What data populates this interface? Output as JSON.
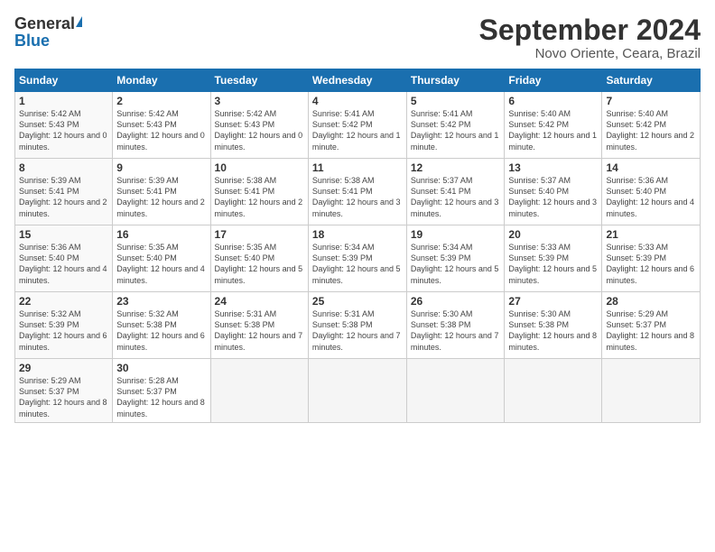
{
  "header": {
    "logo_general": "General",
    "logo_blue": "Blue",
    "month_title": "September 2024",
    "location": "Novo Oriente, Ceara, Brazil"
  },
  "days_of_week": [
    "Sunday",
    "Monday",
    "Tuesday",
    "Wednesday",
    "Thursday",
    "Friday",
    "Saturday"
  ],
  "weeks": [
    [
      {
        "day": 1,
        "sunrise": "5:42 AM",
        "sunset": "5:43 PM",
        "daylight": "12 hours and 0 minutes."
      },
      {
        "day": 2,
        "sunrise": "5:42 AM",
        "sunset": "5:43 PM",
        "daylight": "12 hours and 0 minutes."
      },
      {
        "day": 3,
        "sunrise": "5:42 AM",
        "sunset": "5:43 PM",
        "daylight": "12 hours and 0 minutes."
      },
      {
        "day": 4,
        "sunrise": "5:41 AM",
        "sunset": "5:42 PM",
        "daylight": "12 hours and 1 minute."
      },
      {
        "day": 5,
        "sunrise": "5:41 AM",
        "sunset": "5:42 PM",
        "daylight": "12 hours and 1 minute."
      },
      {
        "day": 6,
        "sunrise": "5:40 AM",
        "sunset": "5:42 PM",
        "daylight": "12 hours and 1 minute."
      },
      {
        "day": 7,
        "sunrise": "5:40 AM",
        "sunset": "5:42 PM",
        "daylight": "12 hours and 2 minutes."
      }
    ],
    [
      {
        "day": 8,
        "sunrise": "5:39 AM",
        "sunset": "5:41 PM",
        "daylight": "12 hours and 2 minutes."
      },
      {
        "day": 9,
        "sunrise": "5:39 AM",
        "sunset": "5:41 PM",
        "daylight": "12 hours and 2 minutes."
      },
      {
        "day": 10,
        "sunrise": "5:38 AM",
        "sunset": "5:41 PM",
        "daylight": "12 hours and 2 minutes."
      },
      {
        "day": 11,
        "sunrise": "5:38 AM",
        "sunset": "5:41 PM",
        "daylight": "12 hours and 3 minutes."
      },
      {
        "day": 12,
        "sunrise": "5:37 AM",
        "sunset": "5:41 PM",
        "daylight": "12 hours and 3 minutes."
      },
      {
        "day": 13,
        "sunrise": "5:37 AM",
        "sunset": "5:40 PM",
        "daylight": "12 hours and 3 minutes."
      },
      {
        "day": 14,
        "sunrise": "5:36 AM",
        "sunset": "5:40 PM",
        "daylight": "12 hours and 4 minutes."
      }
    ],
    [
      {
        "day": 15,
        "sunrise": "5:36 AM",
        "sunset": "5:40 PM",
        "daylight": "12 hours and 4 minutes."
      },
      {
        "day": 16,
        "sunrise": "5:35 AM",
        "sunset": "5:40 PM",
        "daylight": "12 hours and 4 minutes."
      },
      {
        "day": 17,
        "sunrise": "5:35 AM",
        "sunset": "5:40 PM",
        "daylight": "12 hours and 5 minutes."
      },
      {
        "day": 18,
        "sunrise": "5:34 AM",
        "sunset": "5:39 PM",
        "daylight": "12 hours and 5 minutes."
      },
      {
        "day": 19,
        "sunrise": "5:34 AM",
        "sunset": "5:39 PM",
        "daylight": "12 hours and 5 minutes."
      },
      {
        "day": 20,
        "sunrise": "5:33 AM",
        "sunset": "5:39 PM",
        "daylight": "12 hours and 5 minutes."
      },
      {
        "day": 21,
        "sunrise": "5:33 AM",
        "sunset": "5:39 PM",
        "daylight": "12 hours and 6 minutes."
      }
    ],
    [
      {
        "day": 22,
        "sunrise": "5:32 AM",
        "sunset": "5:39 PM",
        "daylight": "12 hours and 6 minutes."
      },
      {
        "day": 23,
        "sunrise": "5:32 AM",
        "sunset": "5:38 PM",
        "daylight": "12 hours and 6 minutes."
      },
      {
        "day": 24,
        "sunrise": "5:31 AM",
        "sunset": "5:38 PM",
        "daylight": "12 hours and 7 minutes."
      },
      {
        "day": 25,
        "sunrise": "5:31 AM",
        "sunset": "5:38 PM",
        "daylight": "12 hours and 7 minutes."
      },
      {
        "day": 26,
        "sunrise": "5:30 AM",
        "sunset": "5:38 PM",
        "daylight": "12 hours and 7 minutes."
      },
      {
        "day": 27,
        "sunrise": "5:30 AM",
        "sunset": "5:38 PM",
        "daylight": "12 hours and 8 minutes."
      },
      {
        "day": 28,
        "sunrise": "5:29 AM",
        "sunset": "5:37 PM",
        "daylight": "12 hours and 8 minutes."
      }
    ],
    [
      {
        "day": 29,
        "sunrise": "5:29 AM",
        "sunset": "5:37 PM",
        "daylight": "12 hours and 8 minutes."
      },
      {
        "day": 30,
        "sunrise": "5:28 AM",
        "sunset": "5:37 PM",
        "daylight": "12 hours and 8 minutes."
      },
      null,
      null,
      null,
      null,
      null
    ]
  ]
}
